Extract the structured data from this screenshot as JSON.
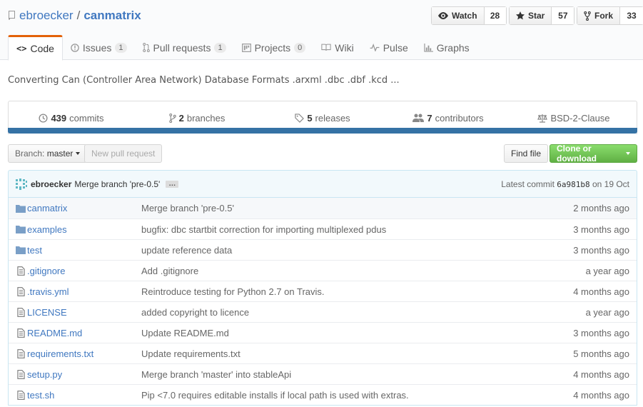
{
  "repo": {
    "owner": "ebroecker",
    "separator": "/",
    "name": "canmatrix"
  },
  "social": {
    "watch": {
      "label": "Watch",
      "count": "28"
    },
    "star": {
      "label": "Star",
      "count": "57"
    },
    "fork": {
      "label": "Fork",
      "count": "33"
    }
  },
  "tabs": [
    {
      "label": "Code",
      "icon": "code-icon"
    },
    {
      "label": "Issues",
      "counter": "1",
      "icon": "issue-icon"
    },
    {
      "label": "Pull requests",
      "counter": "1",
      "icon": "pull-request-icon"
    },
    {
      "label": "Projects",
      "counter": "0",
      "icon": "project-icon"
    },
    {
      "label": "Wiki",
      "icon": "book-icon"
    },
    {
      "label": "Pulse",
      "icon": "pulse-icon"
    },
    {
      "label": "Graphs",
      "icon": "graph-icon"
    }
  ],
  "description": "Converting Can (Controller Area Network) Database Formats .arxml .dbc .dbf .kcd ...",
  "numbers": {
    "commits": {
      "value": "439",
      "label": "commits"
    },
    "branches": {
      "value": "2",
      "label": "branches"
    },
    "releases": {
      "value": "5",
      "label": "releases"
    },
    "contributors": {
      "value": "7",
      "label": "contributors"
    },
    "license": "BSD-2-Clause"
  },
  "language_color": "#3572A5",
  "toolbar": {
    "branch_prefix": "Branch:",
    "branch_name": "master",
    "new_pull_request": "New pull request",
    "find_file": "Find file",
    "clone_download": "Clone or download"
  },
  "latest_commit": {
    "author": "ebroecker",
    "message": "Merge branch 'pre-0.5'",
    "ellipsis": "…",
    "prefix": "Latest commit",
    "sha": "6a981b8",
    "date": "on 19 Oct"
  },
  "files": [
    {
      "type": "dir",
      "name": "canmatrix",
      "message": "Merge branch 'pre-0.5'",
      "age": "2 months ago"
    },
    {
      "type": "dir",
      "name": "examples",
      "message": "bugfix: dbc startbit correction for importing multiplexed pdus",
      "age": "3 months ago"
    },
    {
      "type": "dir",
      "name": "test",
      "message": "update reference data",
      "age": "3 months ago"
    },
    {
      "type": "file",
      "name": ".gitignore",
      "message": "Add .gitignore",
      "age": "a year ago"
    },
    {
      "type": "file",
      "name": ".travis.yml",
      "message": "Reintroduce testing for Python 2.7 on Travis.",
      "age": "4 months ago"
    },
    {
      "type": "file",
      "name": "LICENSE",
      "message": "added copyright to licence",
      "age": "a year ago"
    },
    {
      "type": "file",
      "name": "README.md",
      "message": "Update README.md",
      "age": "3 months ago"
    },
    {
      "type": "file",
      "name": "requirements.txt",
      "message": "Update requirements.txt",
      "age": "5 months ago"
    },
    {
      "type": "file",
      "name": "setup.py",
      "message": "Merge branch 'master' into stableApi",
      "age": "4 months ago"
    },
    {
      "type": "file",
      "name": "test.sh",
      "message": "Pip <7.0 requires editable installs if local path is used with extras.",
      "age": "4 months ago"
    }
  ]
}
